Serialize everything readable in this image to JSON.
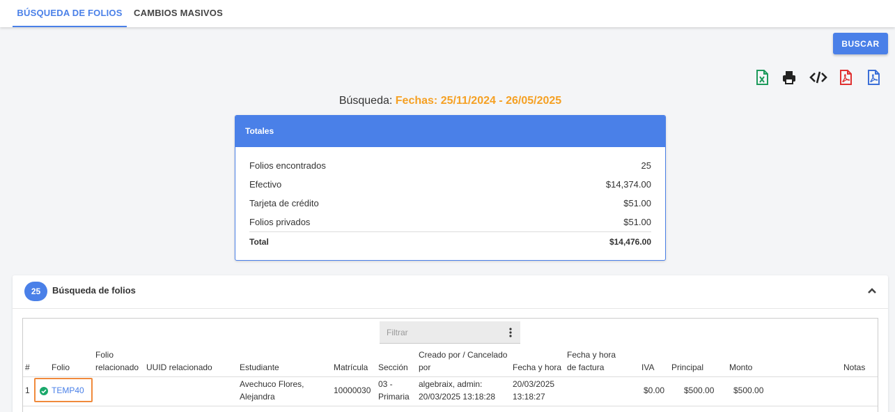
{
  "tabs": [
    {
      "label": "BÚSQUEDA DE FOLIOS",
      "active": true
    },
    {
      "label": "CAMBIOS MASIVOS",
      "active": false
    }
  ],
  "actions": {
    "search_button": "BUSCAR",
    "export_icons": [
      "excel-icon",
      "print-icon",
      "code-icon",
      "pdf-red-icon",
      "pdf-blue-icon"
    ]
  },
  "search": {
    "label": "Búsqueda:",
    "value": "Fechas: 25/11/2024 - 26/05/2025"
  },
  "totals": {
    "title": "Totales",
    "rows": [
      {
        "label": "Folios encontrados",
        "value": "25"
      },
      {
        "label": "Efectivo",
        "value": "$14,374.00"
      },
      {
        "label": "Tarjeta de crédito",
        "value": "$51.00"
      },
      {
        "label": "Folios privados",
        "value": "$51.00"
      }
    ],
    "total_label": "Total",
    "total_value": "$14,476.00"
  },
  "results": {
    "count": "25",
    "title": "Búsqueda de folios",
    "filter_placeholder": "Filtrar",
    "columns": [
      "#",
      "Folio",
      "Folio relacionado",
      "UUID relacionado",
      "Estudiante",
      "Matrícula",
      "Sección",
      "Creado por / Cancelado por",
      "Fecha y hora",
      "Fecha y hora de factura",
      "IVA",
      "Principal",
      "Monto",
      "Notas"
    ],
    "rows": [
      {
        "num": "1",
        "folio": "TEMP40",
        "estudiante": "Avechuco Flores, Alejandra",
        "matricula": "10000030",
        "seccion": "03 - Primaria",
        "creado": "algebraix, admin: 20/03/2025 13:18:28",
        "fecha": "20/03/2025 13:18:27",
        "iva": "$0.00",
        "principal": "$500.00",
        "monto": "$500.00"
      }
    ]
  },
  "colors": {
    "primary": "#4a80e8",
    "accent": "#f5a023",
    "highlight": "#f08a3c",
    "success": "#1aa86b"
  }
}
